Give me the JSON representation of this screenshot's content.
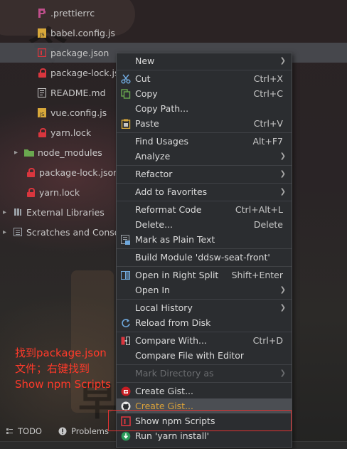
{
  "tree": {
    "rows": [
      {
        "label": ".prettierrc",
        "icon": "prettier-icon"
      },
      {
        "label": "babel.config.js",
        "icon": "js-file-icon"
      },
      {
        "label": "package.json",
        "icon": "npm-icon"
      },
      {
        "label": "package-lock.json",
        "icon": "lock-icon"
      },
      {
        "label": "README.md",
        "icon": "markdown-icon"
      },
      {
        "label": "vue.config.js",
        "icon": "js-file-icon"
      },
      {
        "label": "yarn.lock",
        "icon": "lock-icon"
      },
      {
        "label": "node_modules",
        "icon": "folder-icon"
      },
      {
        "label": "package-lock.json",
        "icon": "lock-icon"
      },
      {
        "label": "yarn.lock",
        "icon": "lock-icon"
      },
      {
        "label": "External Libraries",
        "icon": "library-icon"
      },
      {
        "label": "Scratches and Console",
        "icon": "scratches-icon"
      }
    ]
  },
  "annotation": {
    "line1": "找到package.json",
    "line2": "文件；右键找到",
    "line3": "Show npm Scripts"
  },
  "bottombar": {
    "todo": "TODO",
    "problems": "Problems"
  },
  "menu": {
    "new": "New",
    "cut": "Cut",
    "cut_shortcut": "Ctrl+X",
    "copy": "Copy",
    "copy_shortcut": "Ctrl+C",
    "copy_path": "Copy Path...",
    "paste": "Paste",
    "paste_shortcut": "Ctrl+V",
    "find_usages": "Find Usages",
    "find_usages_shortcut": "Alt+F7",
    "analyze": "Analyze",
    "refactor": "Refactor",
    "add_to_favorites": "Add to Favorites",
    "reformat_code": "Reformat Code",
    "reformat_shortcut": "Ctrl+Alt+L",
    "delete": "Delete...",
    "delete_shortcut": "Delete",
    "mark_plain_text": "Mark as Plain Text",
    "build_module": "Build Module 'ddsw-seat-front'",
    "open_right_split": "Open in Right Split",
    "open_right_split_shortcut": "Shift+Enter",
    "open_in": "Open In",
    "local_history": "Local History",
    "reload_from_disk": "Reload from Disk",
    "compare_with": "Compare With...",
    "compare_with_shortcut": "Ctrl+D",
    "compare_file_editor": "Compare File with Editor",
    "mark_directory_as": "Mark Directory as",
    "create_gist_1": "Create Gist...",
    "create_gist_2": "Create Gist...",
    "show_npm_scripts": "Show npm Scripts",
    "run_yarn_install": "Run 'yarn install'"
  },
  "colors": {
    "menu_bg": "#2b2d30",
    "highlight_text": "#d9a13a",
    "annotation_red": "#ff3a2a",
    "lock_red": "#d9363e"
  }
}
